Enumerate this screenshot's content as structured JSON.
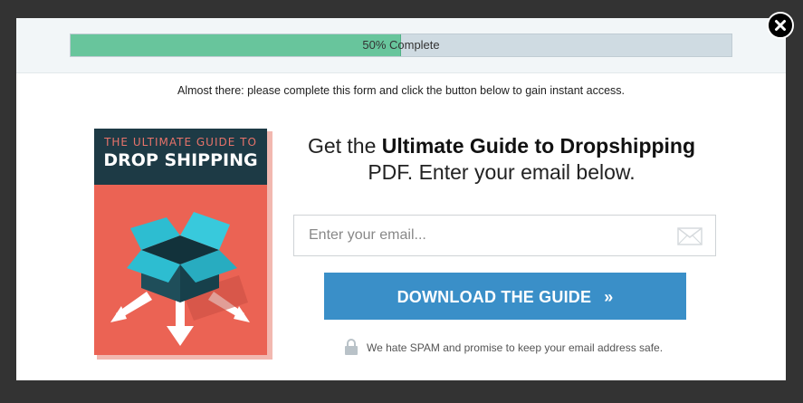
{
  "progress": {
    "label": "50% Complete",
    "percent": 50
  },
  "instruction": "Almost there: please complete this form and click the button below to gain instant access.",
  "book": {
    "subtitle": "THE ULTIMATE GUIDE TO",
    "title": "DROP SHIPPING",
    "art_icon": "open-box-arrows"
  },
  "headline": {
    "prefix": "Get the ",
    "bold": "Ultimate Guide to Dropshipping",
    "line2": "PDF. Enter your email below."
  },
  "email": {
    "placeholder": "Enter your email...",
    "value": "",
    "icon": "envelope-icon"
  },
  "cta": {
    "label": "DOWNLOAD THE GUIDE",
    "arrow": "»"
  },
  "privacy": {
    "text": "We hate SPAM and promise to keep your email address safe.",
    "icon": "lock-icon"
  },
  "close": {
    "icon": "close-icon",
    "glyph": "×"
  },
  "colors": {
    "overlay": "#333333",
    "progress_fill": "#68c59c",
    "progress_track": "#cfdbe2",
    "button": "#3a8fc8",
    "book_cover": "#eb6354",
    "book_header": "#1d3a45",
    "box_teal": "#2dbdd1"
  }
}
